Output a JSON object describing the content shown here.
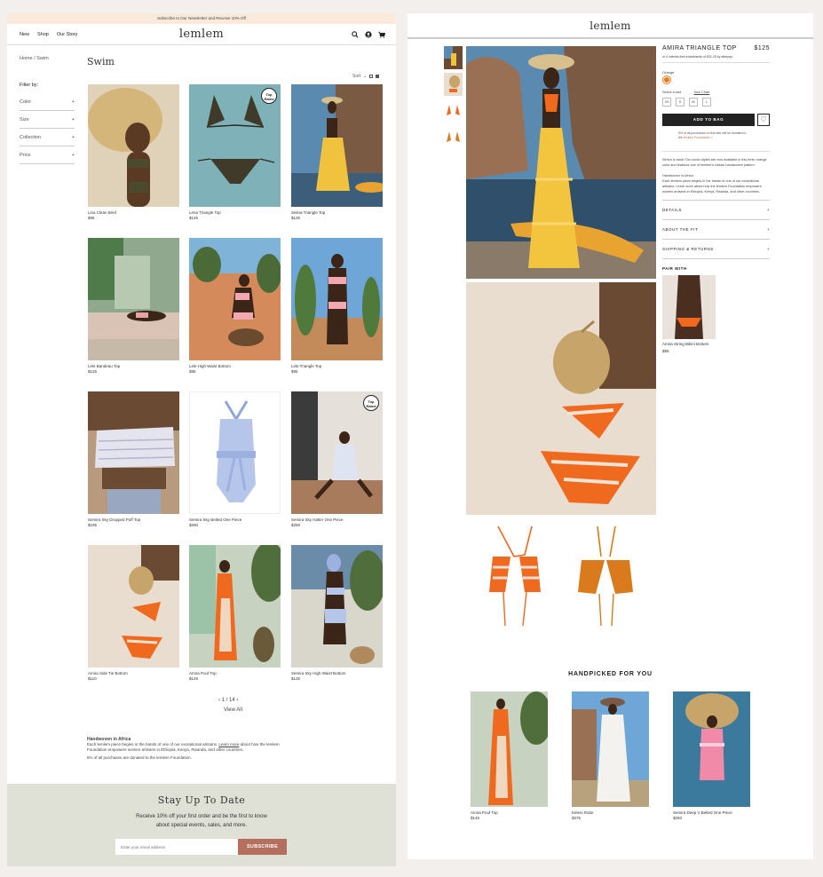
{
  "left": {
    "announcement": "Subscribe to Our Newsletter and Receive 10% Off",
    "nav": [
      "New",
      "Shop",
      "Our Story"
    ],
    "logo": "lemlem",
    "breadcrumb": "Home / Swim",
    "page_title": "Swim",
    "filter": {
      "title": "Filter by:",
      "rows": [
        "Color",
        "Size",
        "Collection",
        "Price"
      ],
      "plus": "+"
    },
    "sort_label": "Sort",
    "products": [
      {
        "name": "Lina Clean Brief",
        "price": "$95"
      },
      {
        "name": "Lena Triangle Top",
        "price": "$125",
        "badge": "Top Rated"
      },
      {
        "name": "Selina Triangle Top",
        "price": "$125"
      },
      {
        "name": "Lele Bandeau Top",
        "price": "$125"
      },
      {
        "name": "Lele High Waist Bottom",
        "price": "$95"
      },
      {
        "name": "Lele Triangle Top",
        "price": "$95"
      },
      {
        "name": "Semira Sky Dropped Puff Top",
        "price": "$195"
      },
      {
        "name": "Semira Sky Belted One Piece",
        "price": "$290"
      },
      {
        "name": "Semira Sky Halter One Piece",
        "price": "$250",
        "badge": "Top Rated"
      },
      {
        "name": "Amira Side Tie Bottom",
        "price": "$110"
      },
      {
        "name": "Amira Pouf Top",
        "price": "$125"
      },
      {
        "name": "Semira Sky High Waist Bottom",
        "price": "$125"
      }
    ],
    "pager": {
      "prev": "‹",
      "text": "1 / 14",
      "next": "›"
    },
    "view_all": "View All",
    "info": {
      "title": "Handwoven in Africa",
      "line1": "Each lemlem piece begins in the hands of one of our exceptional artisans.",
      "link": "Learn more",
      "line2": "about how the lemlem Foundation empowers women artisans in Ethiopia, Kenya, Rwanda, and other countries.",
      "line3": "5% of all purchases are donated to the lemlem Foundation."
    },
    "footer": {
      "heading": "Stay Up To Date",
      "sub": "Receive 10% off your first order and be the first to know about special events, sales, and more.",
      "placeholder": "Enter your email address",
      "button": "SUBSCRIBE"
    }
  },
  "right": {
    "logo": "lemlem",
    "product_title": "AMIRA TRIANGLE TOP",
    "price": "$125",
    "afterpay": "or 4 interest-free installments of $31.25 by afterpay",
    "color_label": "Orange",
    "select_size": "Select a size",
    "size_chart": "Size Chart",
    "sizes": [
      "XS",
      "S",
      "M",
      "L"
    ],
    "add_to_bag": "ADD TO BAG",
    "donate_text": "5% of all purchases on this site will be donated to the",
    "donate_link": "lemlem Foundation >",
    "description": "Simira is back! Our iconic styles are now available in this fresh orange color and features one of lemlem's classic handwoven pattern.",
    "hw_title": "Handwoven in Africa",
    "hw_text": "Each lemlem piece begins in the hands of one of our exceptional artisans. Learn more about how the lemlem Foundation empowers women artisans in Ethiopia, Kenya, Rwanda, and other countries.",
    "accordions": [
      "DETAILS",
      "ABOUT THE FIT",
      "SHIPPING & RETURNS"
    ],
    "pair_with": "PAIR WITH",
    "pair_name": "Amira String Bikini Bottom",
    "pair_price": "$95",
    "handpicked_title": "HANDPICKED FOR YOU",
    "handpicked": [
      {
        "name": "Amira Pouf Top",
        "price": "$145"
      },
      {
        "name": "Keleni Robe",
        "price": "$375"
      },
      {
        "name": "Semira Deep V Belted One Piece",
        "price": "$250"
      }
    ]
  },
  "colors": {
    "accent": "#b66e5e",
    "orange": "#f07a1a",
    "footer_bg": "#dfe0d6",
    "announce_bg": "#fbe9dc"
  }
}
